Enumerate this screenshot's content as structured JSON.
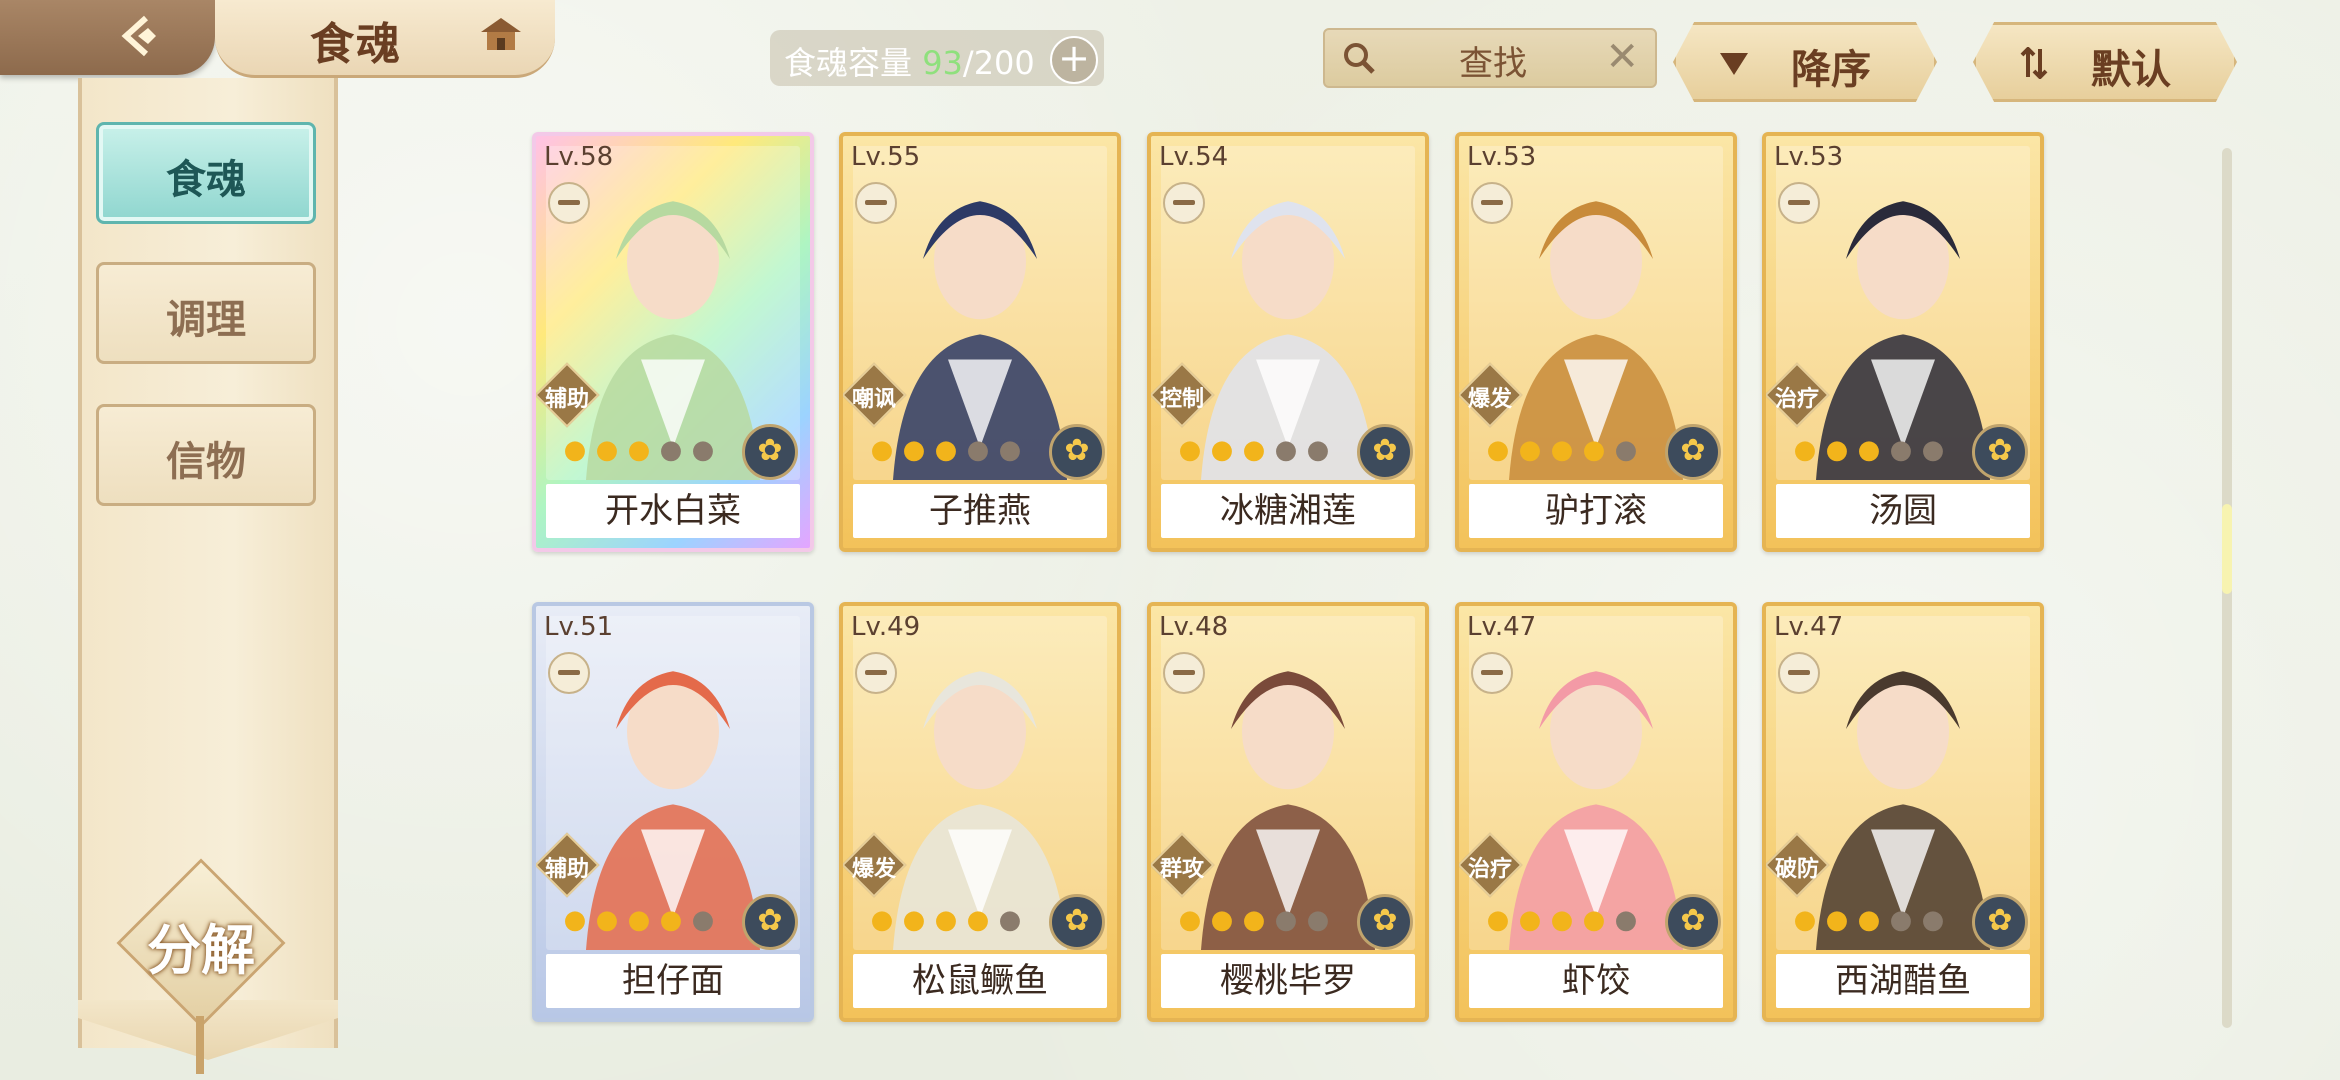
{
  "header": {
    "title": "食魂",
    "capacity": {
      "label": "食魂容量",
      "current": "93",
      "sep": "/",
      "max": "200",
      "add": "+"
    },
    "search": {
      "text": "查找",
      "clear": "✕"
    },
    "sort_desc": "降序",
    "sort_default": "默认"
  },
  "sidebar": {
    "tabs": [
      {
        "label": "食魂",
        "active": true
      },
      {
        "label": "调理",
        "active": false
      },
      {
        "label": "信物",
        "active": false
      }
    ],
    "decompose": "分解"
  },
  "cards": [
    {
      "level": "Lv.58",
      "role": "辅助",
      "name": "开水白菜",
      "stars_on": 3,
      "stars_total": 5,
      "frame": "rainbow",
      "accent": "#b7d9a0"
    },
    {
      "level": "Lv.55",
      "role": "嘲讽",
      "name": "子推燕",
      "stars_on": 3,
      "stars_total": 5,
      "frame": "gold",
      "accent": "#2d3a66"
    },
    {
      "level": "Lv.54",
      "role": "控制",
      "name": "冰糖湘莲",
      "stars_on": 3,
      "stars_total": 5,
      "frame": "gold",
      "accent": "#dfe3ee"
    },
    {
      "level": "Lv.53",
      "role": "爆发",
      "name": "驴打滚",
      "stars_on": 4,
      "stars_total": 5,
      "frame": "gold",
      "accent": "#c88b3a"
    },
    {
      "level": "Lv.53",
      "role": "治疗",
      "name": "汤圆",
      "stars_on": 3,
      "stars_total": 5,
      "frame": "gold",
      "accent": "#2a2a3a"
    },
    {
      "level": "Lv.51",
      "role": "辅助",
      "name": "担仔面",
      "stars_on": 4,
      "stars_total": 5,
      "frame": "silver",
      "accent": "#e46a4a"
    },
    {
      "level": "Lv.49",
      "role": "爆发",
      "name": "松鼠鳜鱼",
      "stars_on": 4,
      "stars_total": 5,
      "frame": "gold",
      "accent": "#e8e6dc"
    },
    {
      "level": "Lv.48",
      "role": "群攻",
      "name": "樱桃毕罗",
      "stars_on": 3,
      "stars_total": 5,
      "frame": "gold",
      "accent": "#7a4a3a"
    },
    {
      "level": "Lv.47",
      "role": "治疗",
      "name": "虾饺",
      "stars_on": 4,
      "stars_total": 5,
      "frame": "gold",
      "accent": "#f39aa6"
    },
    {
      "level": "Lv.47",
      "role": "破防",
      "name": "西湖醋鱼",
      "stars_on": 3,
      "stars_total": 5,
      "frame": "gold",
      "accent": "#4a3a2e"
    }
  ],
  "scroll_position": 0.45
}
